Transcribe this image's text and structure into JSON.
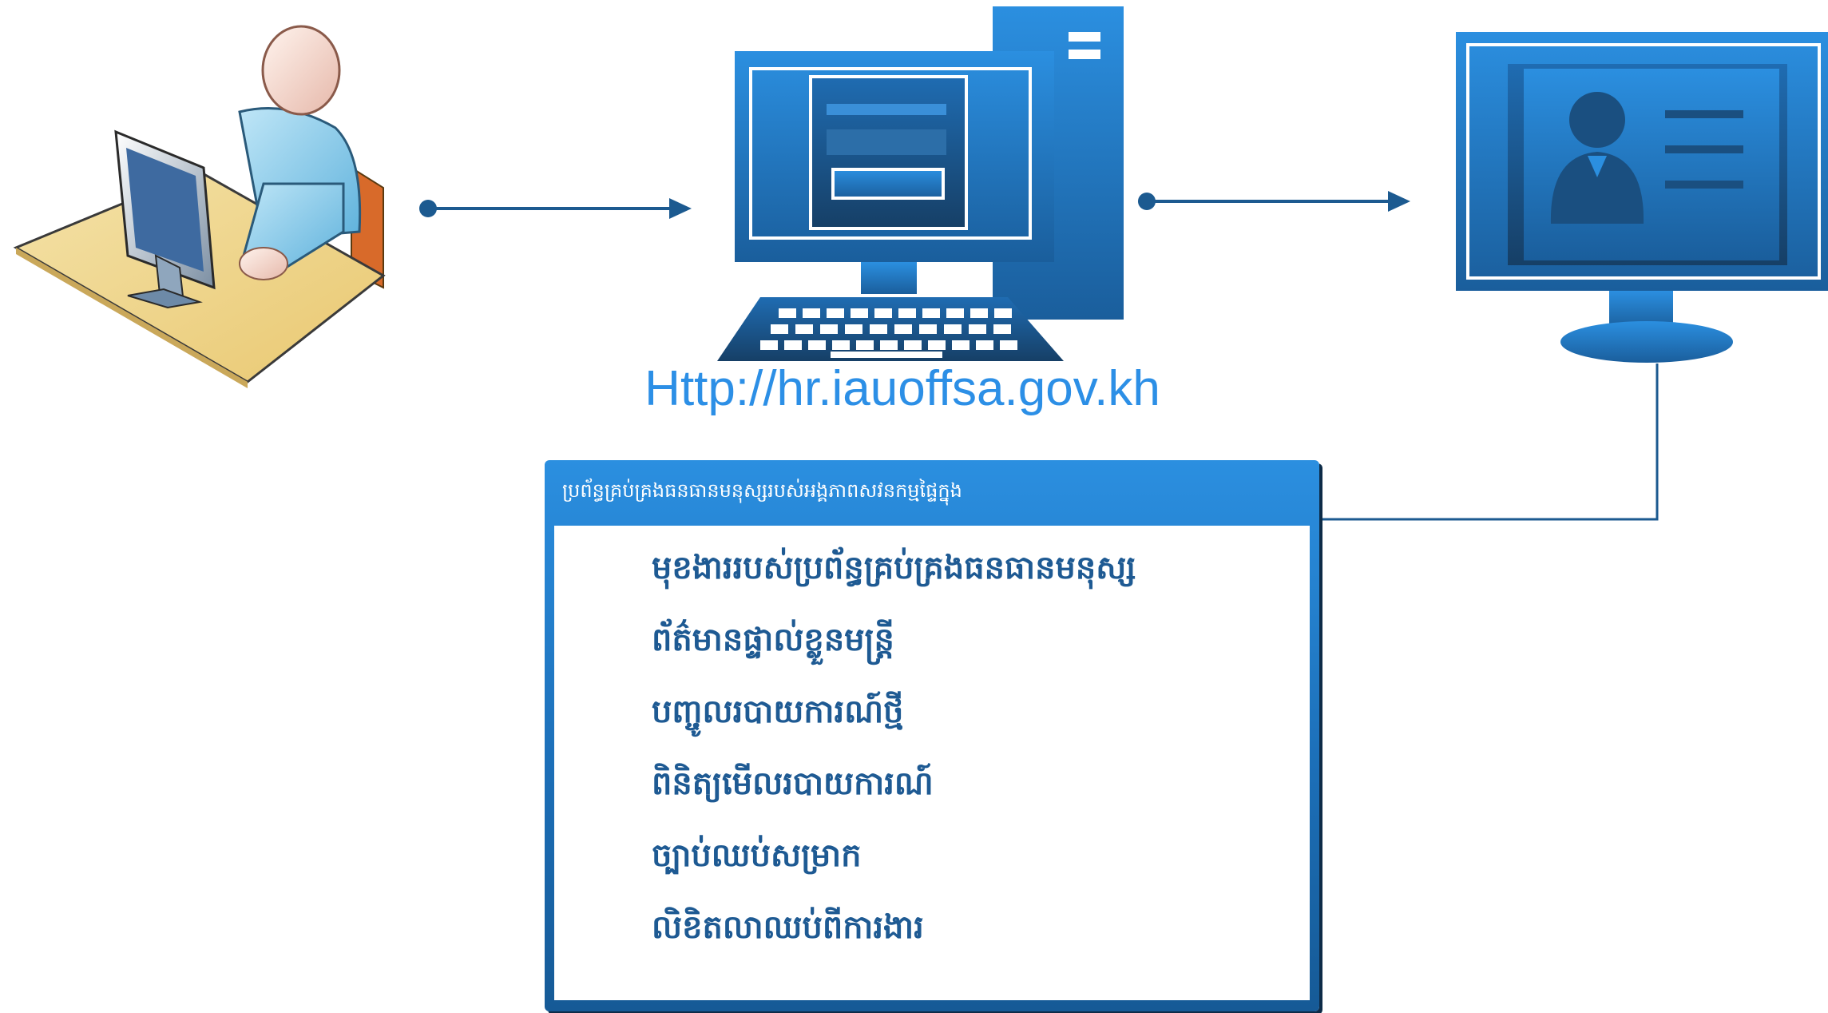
{
  "url_label": "Http://hr.iauoffsa.gov.kh",
  "window": {
    "title": "ប្រព័ន្ធគ្រប់គ្រងធនធានមនុស្សរបស់អង្គភាពសវនកម្មផ្ទៃក្នុង",
    "menu_items": [
      "មុខងាររបស់ប្រព័ន្ធគ្រប់គ្រងធនធានមនុស្ស",
      "ព័ត៌មានផ្ទាល់ខ្លួនមន្ត្រី",
      "បញ្ចូលរបាយការណ៍ថ្មី",
      "ពិនិត្យមើលរបាយការណ៍",
      "ច្បាប់ឈប់សម្រាក",
      "លិខិតលាឈប់ពីការងារ"
    ]
  },
  "icons": {
    "user": "user-at-desk-icon",
    "server": "desktop-computer-icon",
    "profile": "profile-monitor-icon"
  },
  "colors": {
    "primary": "#1c6fb8",
    "light": "#2b8fe0",
    "dark": "#1a4f80",
    "link": "#2c8fe6",
    "text": "#1e5a93"
  }
}
